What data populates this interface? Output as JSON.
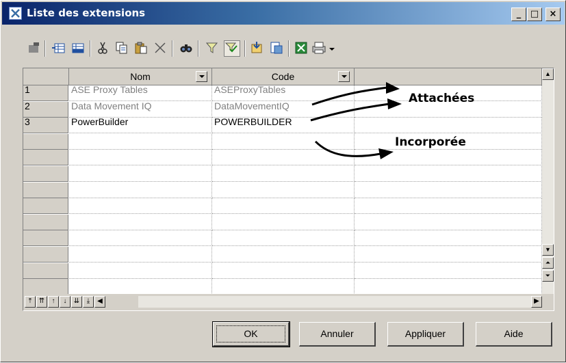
{
  "window": {
    "title": "Liste des extensions",
    "controls": {
      "minimize": "_",
      "maximize": "□",
      "close": "×"
    }
  },
  "toolbar": {
    "icons": [
      "properties-icon",
      "insert-row-icon",
      "add-row-icon",
      "cut-icon",
      "copy-icon",
      "paste-icon",
      "delete-icon",
      "find-icon",
      "filter-icon",
      "customize-columns-icon",
      "import-icon",
      "export-icon",
      "excel-icon",
      "print-icon",
      "dropdown-arrow-icon"
    ]
  },
  "grid": {
    "columns": [
      "Nom",
      "Code"
    ],
    "rows": [
      {
        "num": "1",
        "name": "ASE Proxy Tables",
        "code": "ASEProxyTables",
        "attached": true
      },
      {
        "num": "2",
        "name": "Data Movement IQ",
        "code": "DataMovementIQ",
        "attached": true
      },
      {
        "num": "3",
        "name": "PowerBuilder",
        "code": "POWERBUILDER",
        "attached": false
      }
    ],
    "empty_rows": 10
  },
  "annotations": {
    "attached_label": "Attachées",
    "embedded_label": "Incorporée"
  },
  "buttons": {
    "ok": "OK",
    "cancel": "Annuler",
    "apply": "Appliquer",
    "help": "Aide"
  }
}
